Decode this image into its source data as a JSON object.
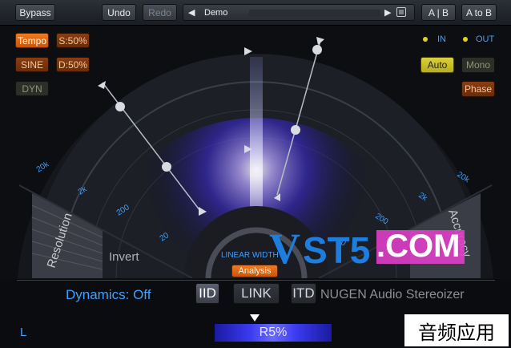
{
  "toolbar": {
    "bypass": "Bypass",
    "undo": "Undo",
    "redo": "Redo",
    "preset_name": "Demo",
    "ab": "A | B",
    "a_to_b": "A to B"
  },
  "left_controls": {
    "tempo": "Tempo",
    "s_value": "S:50%",
    "sine": "SINE",
    "d_value": "D:50%",
    "dyn": "DYN"
  },
  "right_controls": {
    "in": "IN",
    "out": "OUT",
    "auto": "Auto",
    "mono": "Mono",
    "phase": "Phase"
  },
  "display": {
    "left_scale": [
      "20k",
      "2k",
      "200",
      "20"
    ],
    "right_scale": [
      "20k",
      "2k",
      "200",
      "20"
    ],
    "resolution": "Resolution",
    "accuracy": "Accuracy",
    "invert": "Invert",
    "linear_width": "LINEAR WIDTH",
    "analysis": "Analysis"
  },
  "bottom": {
    "dynamics": "Dynamics: Off",
    "iid": "IID",
    "link": "LINK",
    "itd": "ITD",
    "product": "NUGEN Audio Stereoizer",
    "channel_left": "L",
    "readout": "R5%"
  },
  "overlay": {
    "watermark_v": "V",
    "watermark_st5": "ST5",
    "watermark_com": ".COM",
    "caption": "音频应用"
  },
  "colors": {
    "accent_orange": "#f07a1e",
    "accent_yellow": "#d9d03a",
    "accent_blue": "#2a8ee8",
    "watermark_pink": "#e03ec8"
  }
}
